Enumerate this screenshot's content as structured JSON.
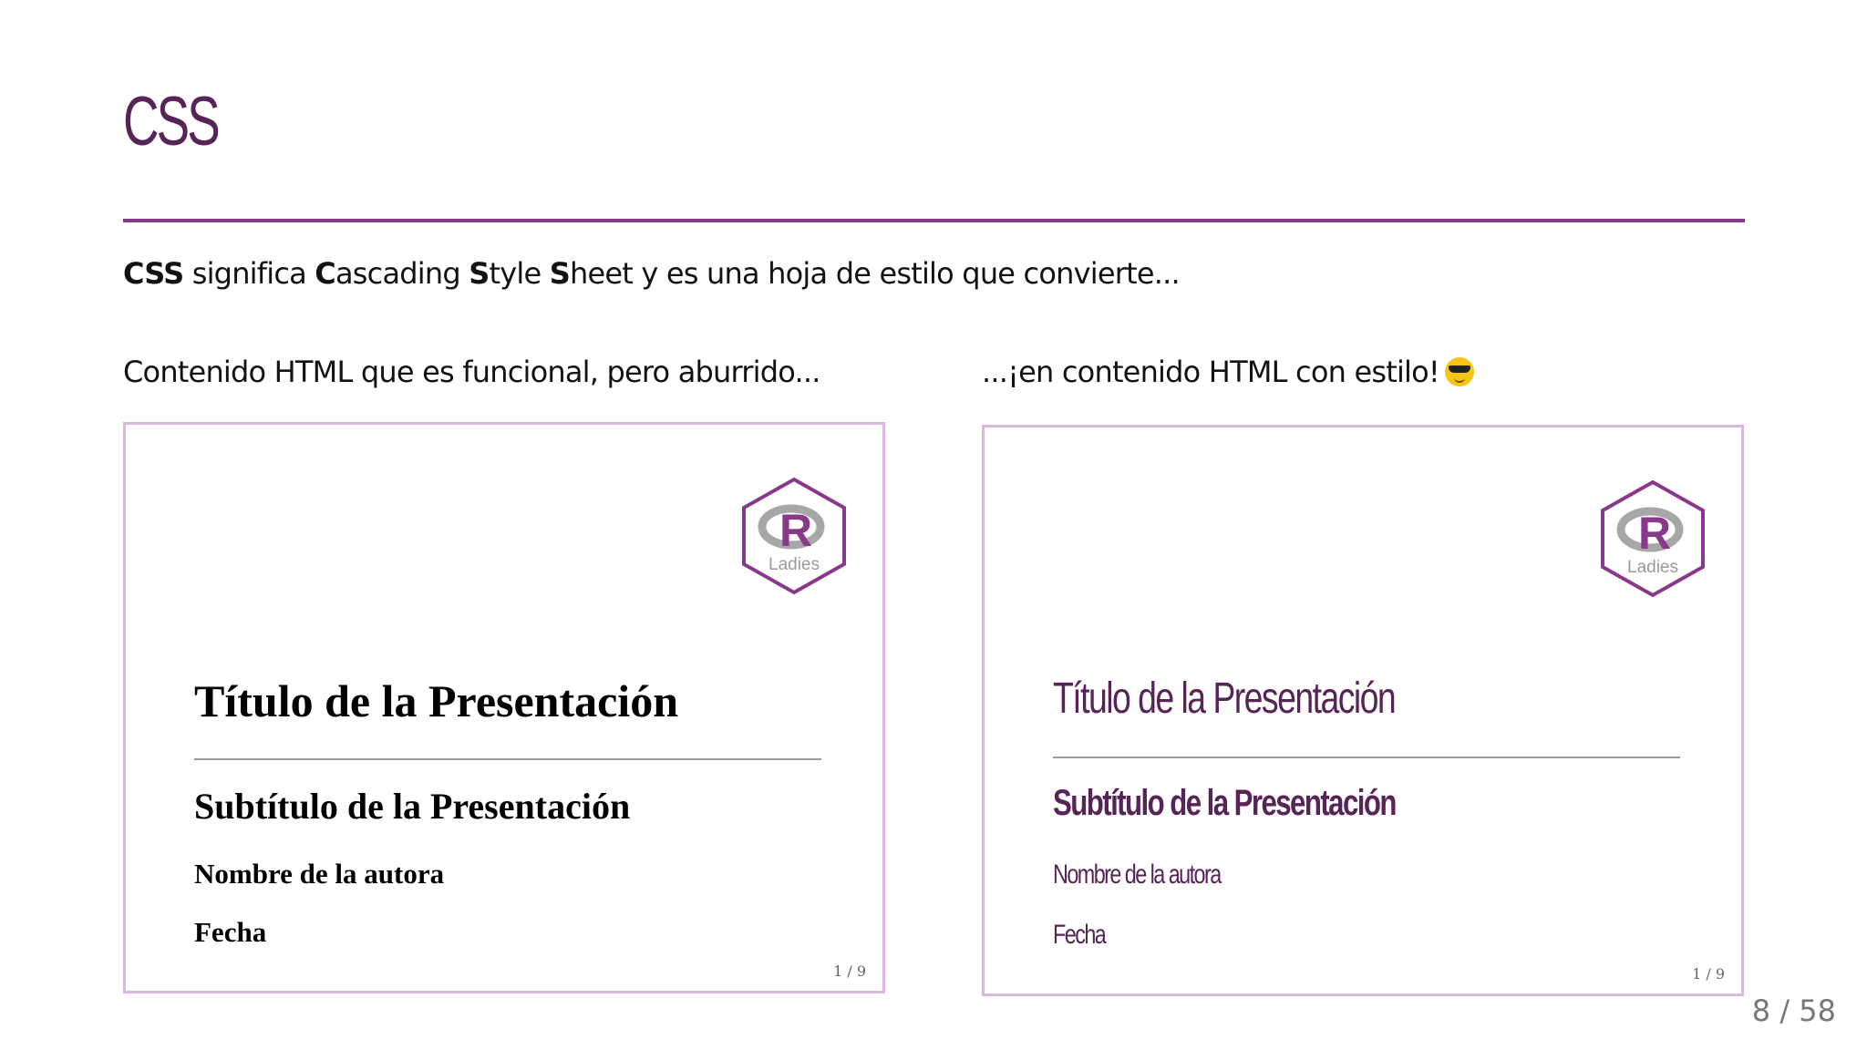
{
  "slide": {
    "title": "CSS",
    "counter": "8 / 58"
  },
  "intro": {
    "acronym": "CSS",
    "part1": " significa ",
    "c": "C",
    "ascading": "ascading ",
    "s1": "S",
    "tyle": "tyle ",
    "s2": "S",
    "rest": "heet y es una hoja de estilo que convierte..."
  },
  "columns": {
    "left_heading": "Contenido HTML que es funcional, pero aburrido...",
    "right_heading": "...¡en contenido HTML con estilo!",
    "right_emoji": "smiling-face-with-sunglasses-icon"
  },
  "preview": {
    "title": "Título de la Presentación",
    "subtitle": "Subtítulo de la Presentación",
    "author": "Nombre de la autora",
    "date": "Fecha",
    "page": "1 / 9",
    "logo_text": "Ladies",
    "logo_letter": "R"
  },
  "colors": {
    "accent_purple": "#562457",
    "rule_purple": "#88398a",
    "frame_border": "#d9b8e0",
    "logo_purple": "#88398a"
  }
}
